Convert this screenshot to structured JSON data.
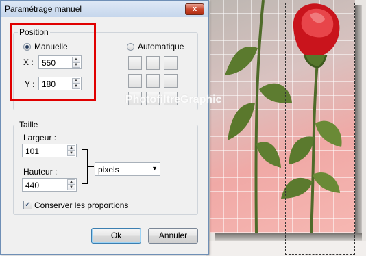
{
  "dialog": {
    "title": "Paramétrage manuel",
    "close_glyph": "x"
  },
  "position": {
    "group_label": "Position",
    "manual_label": "Manuelle",
    "auto_label": "Automatique",
    "mode_selected": "Manuelle",
    "x_label": "X :",
    "x_value": "550",
    "y_label": "Y :",
    "y_value": "180"
  },
  "size": {
    "group_label": "Taille",
    "width_label": "Largeur :",
    "width_value": "101",
    "height_label": "Hauteur :",
    "height_value": "440",
    "unit_selected": "pixels",
    "keep_ratio_label": "Conserver les proportions",
    "keep_ratio_checked": true
  },
  "buttons": {
    "ok": "Ok",
    "cancel": "Annuler"
  },
  "watermark": "PhotofiltreGraphic",
  "colors": {
    "highlight_box": "#e00000",
    "rose": "#d8262c",
    "stem": "#4f6b2a"
  },
  "icons": {
    "close": "close-icon",
    "spin_up": "arrow-up-icon",
    "spin_down": "arrow-down-icon",
    "dropdown": "chevron-down-icon",
    "check": "checkmark-icon"
  }
}
